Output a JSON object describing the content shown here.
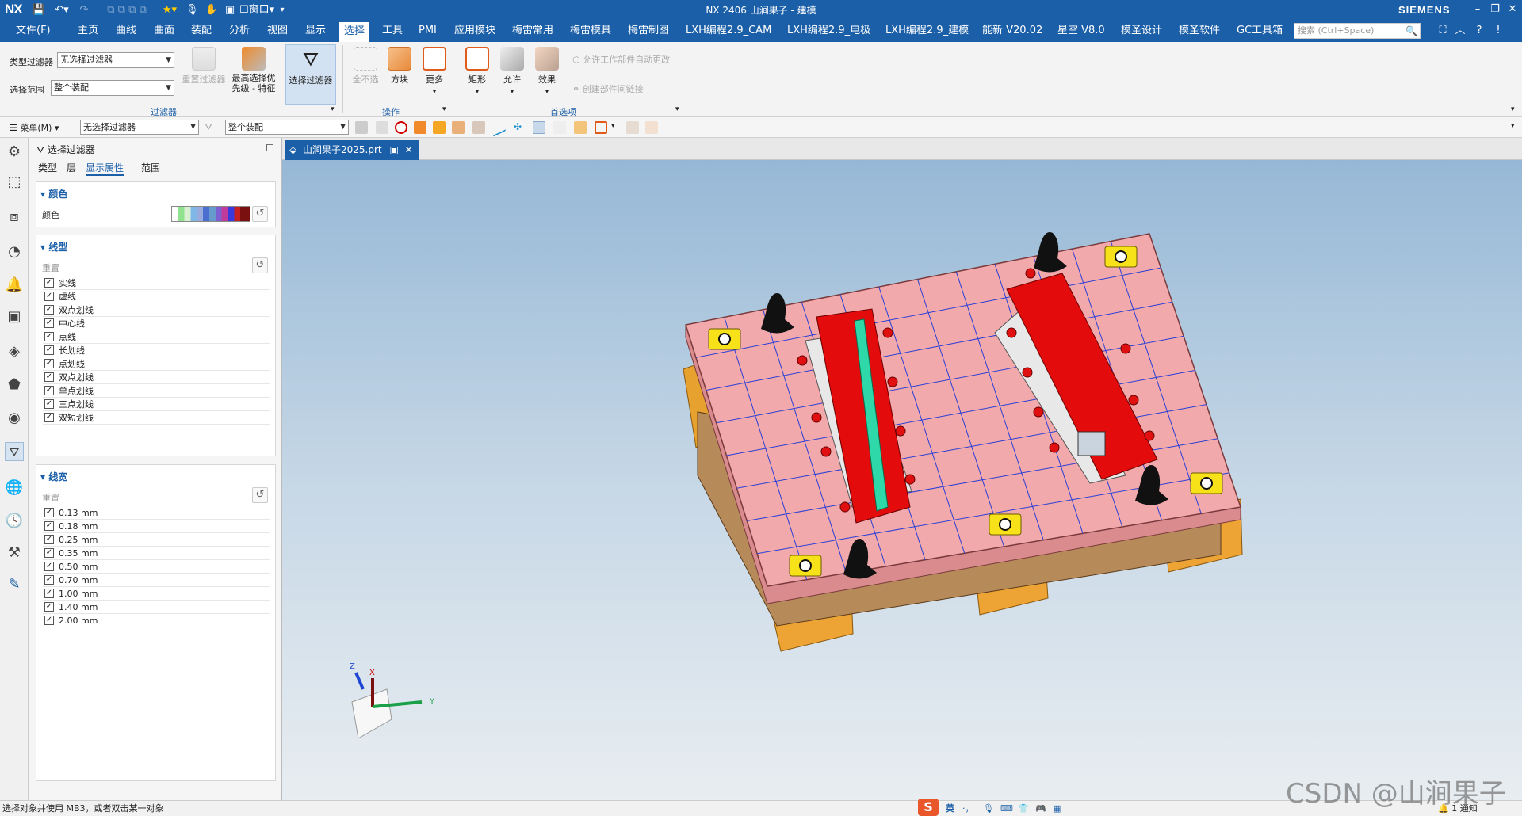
{
  "titlebar": {
    "logo": "NX",
    "window_menu_label": "窗口",
    "title": "NX 2406 山涧果子 - 建模",
    "brand": "SIEMENS"
  },
  "menubar": {
    "items": [
      "文件(F)",
      "主页",
      "曲线",
      "曲面",
      "装配",
      "分析",
      "视图",
      "显示",
      "选择",
      "工具",
      "PMI",
      "应用模块",
      "梅雷常用",
      "梅雷模具",
      "梅雷制图",
      "LXH编程2.9_CAM",
      "LXH编程2.9_电极",
      "LXH编程2.9_建模",
      "能新 V20.02",
      "星空 V8.0",
      "模圣设计",
      "模圣软件",
      "GC工具箱"
    ],
    "active": "选择",
    "search_placeholder": "搜索 (Ctrl+Space)"
  },
  "ribbon": {
    "type_filter_label": "类型过滤器",
    "type_filter_value": "无选择过滤器",
    "scope_label": "选择范围",
    "scope_value": "整个装配",
    "reset_filter": "重置过滤器",
    "highest_priority_line1": "最高选择优",
    "highest_priority_line2": "先级 - 特征",
    "select_filter": "选择过滤器",
    "group_filter": "过滤器",
    "deselect_all": "全不选",
    "block": "方块",
    "more": "更多",
    "group_operation": "操作",
    "rectangle": "矩形",
    "allow": "允许",
    "effect": "效果",
    "allow_auto_change": "允许工作部件自动更改",
    "create_link": "创建部件间链接",
    "group_preferences": "首选项"
  },
  "toolbar2": {
    "menu_label": "菜单(M)",
    "filter_value": "无选择过滤器",
    "scope_value": "整个装配"
  },
  "panel": {
    "title": "选择过滤器",
    "tabs": [
      "类型",
      "层",
      "显示属性",
      "范围"
    ],
    "active_tab": "显示属性",
    "color_section": "颜色",
    "color_label": "颜色",
    "linetype_section": "线型",
    "linetype_reset": "重置",
    "linetypes": [
      "实线",
      "虚线",
      "双点划线",
      "中心线",
      "点线",
      "长划线",
      "点划线",
      "双点划线",
      "单点划线",
      "三点划线",
      "双短划线"
    ],
    "linewidth_section": "线宽",
    "linewidth_reset": "重置",
    "linewidths": [
      "0.13 mm",
      "0.18 mm",
      "0.25 mm",
      "0.35 mm",
      "0.50 mm",
      "0.70 mm",
      "1.00 mm",
      "1.40 mm",
      "2.00 mm"
    ]
  },
  "viewport": {
    "doc_tab": "山涧果子2025.prt",
    "axis_z": "Z",
    "axis_x": "X",
    "axis_y": "Y"
  },
  "statusbar": {
    "message": "选择对象并使用 MB3，或者双击某一对象",
    "ime_lang": "英",
    "notify": "1 通知"
  },
  "watermark": "CSDN @山涧果子",
  "colors": {
    "accent": "#1b5fa8",
    "plate": "#f2a9ab",
    "rail_red": "#e30b0b",
    "grid": "#2a3fd6"
  }
}
